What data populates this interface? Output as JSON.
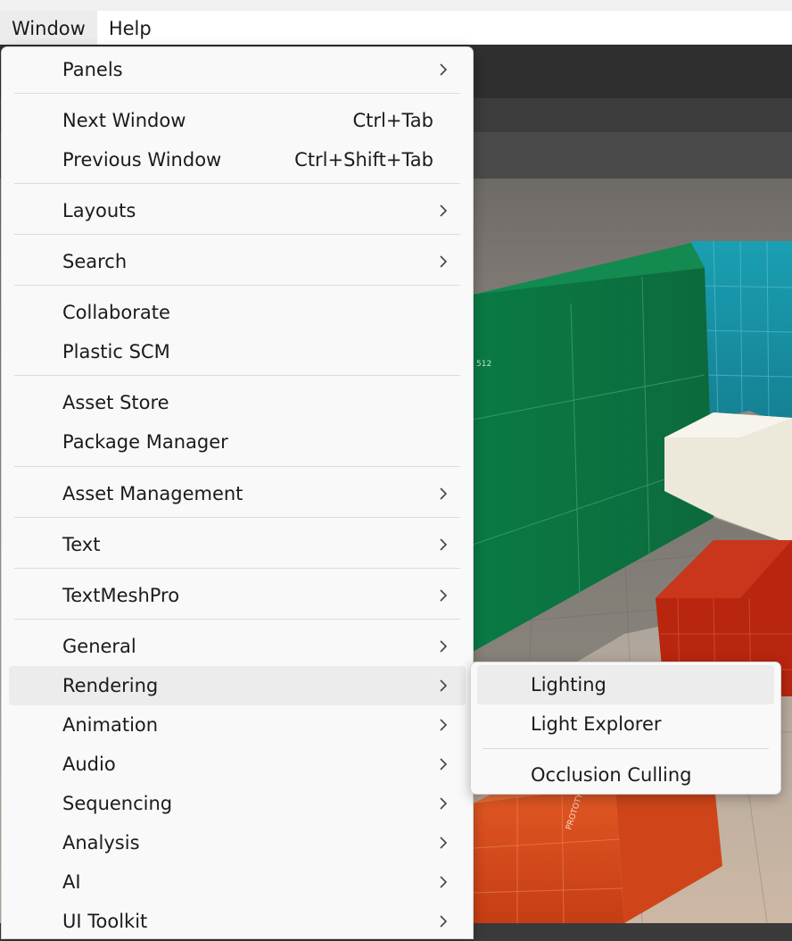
{
  "menubar": {
    "items": [
      {
        "label": "Window"
      },
      {
        "label": "Help"
      }
    ]
  },
  "window_menu": {
    "items": [
      {
        "label": "Panels"
      },
      {
        "label": "Next Window",
        "shortcut": "Ctrl+Tab"
      },
      {
        "label": "Previous Window",
        "shortcut": "Ctrl+Shift+Tab"
      },
      {
        "label": "Layouts"
      },
      {
        "label": "Search"
      },
      {
        "label": "Collaborate"
      },
      {
        "label": "Plastic SCM"
      },
      {
        "label": "Asset Store"
      },
      {
        "label": "Package Manager"
      },
      {
        "label": "Asset Management"
      },
      {
        "label": "Text"
      },
      {
        "label": "TextMeshPro"
      },
      {
        "label": "General"
      },
      {
        "label": "Rendering"
      },
      {
        "label": "Animation"
      },
      {
        "label": "Audio"
      },
      {
        "label": "Sequencing"
      },
      {
        "label": "Analysis"
      },
      {
        "label": "AI"
      },
      {
        "label": "UI Toolkit"
      }
    ]
  },
  "rendering_submenu": {
    "items": [
      {
        "label": "Lighting"
      },
      {
        "label": "Light Explorer"
      },
      {
        "label": "Occlusion Culling"
      }
    ]
  },
  "scene_texture_labels": {
    "green_wall": "512",
    "red_box_front": "PROTOTYPE"
  },
  "colors": {
    "menu_bg": "#f9f9f9",
    "highlight": "#ececec",
    "separator": "#dcdcdc",
    "green_wall": "#0f7a45",
    "teal_wall": "#1b95a8",
    "red_box": "#b5230f",
    "orange_box": "#d9461c"
  }
}
